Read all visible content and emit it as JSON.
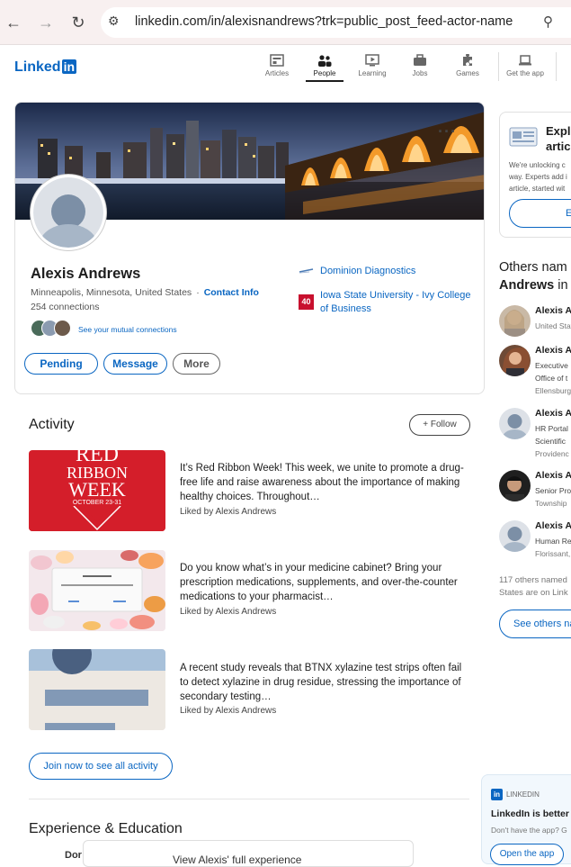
{
  "browser": {
    "url": "linkedin.com/in/alexisnandrews?trk=public_post_feed-actor-name"
  },
  "header": {
    "logo": "Linked",
    "logo_in": "in",
    "nav": [
      {
        "label": "Articles",
        "icon": "articles-icon"
      },
      {
        "label": "People",
        "icon": "people-icon"
      },
      {
        "label": "Learning",
        "icon": "learning-icon"
      },
      {
        "label": "Jobs",
        "icon": "jobs-icon"
      },
      {
        "label": "Games",
        "icon": "games-icon"
      },
      {
        "label": "Get the app",
        "icon": "laptop-icon"
      }
    ],
    "active_nav": "People"
  },
  "profile": {
    "name": "Alexis Andrews",
    "location": "Minneapolis, Minnesota, United States",
    "dot": "·",
    "contact_info": "Contact Info",
    "connections": "254 connections",
    "mutual_text": "See your mutual connections",
    "buttons": {
      "pending": "Pending",
      "message": "Message",
      "more": "More"
    },
    "orgs": [
      {
        "name": "Dominion Diagnostics"
      },
      {
        "name": "Iowa State University - Ivy College of Business",
        "logo_text": "40"
      }
    ]
  },
  "activity": {
    "title": "Activity",
    "follow": "Follow",
    "follow_icon": "+",
    "posts": [
      {
        "text": "It’s Red Ribbon Week! This week, we unite to promote a drug-free life and raise awareness about the importance of making healthy choices. Throughout…",
        "liked": "Liked by Alexis Andrews",
        "thumb": {
          "line1": "RED",
          "line2": "RIBBON",
          "line3": "WEEK",
          "line4": "OCTOBER 23-31"
        }
      },
      {
        "text": "Do you know what’s in your medicine cabinet? Bring your prescription medications, supplements, and over-the-counter medications to your pharmacist…",
        "liked": "Liked by Alexis Andrews"
      },
      {
        "text": "A recent study reveals that BTNX xylazine test strips often fail to detect xylazine in drug residue, stressing the importance of secondary testing…",
        "liked": "Liked by Alexis Andrews"
      }
    ],
    "join_button": "Join now to see all activity"
  },
  "experience": {
    "title": "Experience & Education",
    "partial_left": "Dor",
    "partial_modal": "View Alexis' full experience"
  },
  "right_rail": {
    "explore_title_1": "Explo",
    "explore_title_2": "articl",
    "explore_text_1": "We're unlocking c",
    "explore_text_2": "way. Experts add i",
    "explore_text_3": "article, started wit",
    "explore_button": "E",
    "others_title_1": "Others nam",
    "others_title_2": "Andrews",
    "others_title_3": " in",
    "people": [
      {
        "name": "Alexis A",
        "lines": [
          "United Stat"
        ]
      },
      {
        "name": "Alexis A.",
        "lines": [
          "Executive",
          "Office of t",
          "Ellensburg"
        ]
      },
      {
        "name": "Alexis An",
        "lines": [
          "HR Portal",
          "Scientific",
          "Providenc"
        ]
      },
      {
        "name": "Alexis An",
        "lines": [
          "Senior Pro",
          "Township"
        ]
      },
      {
        "name": "Alexis An",
        "lines": [
          "Human Re",
          "Florissant,"
        ]
      }
    ],
    "others_note_1": "117 others named",
    "others_note_2": "States are on Link",
    "see_others": "See others na"
  },
  "toast": {
    "brand": "LINKEDIN",
    "brand_icon": "in",
    "title": "LinkedIn is better o",
    "sub": "Don't have the app? G",
    "button": "Open the app"
  }
}
